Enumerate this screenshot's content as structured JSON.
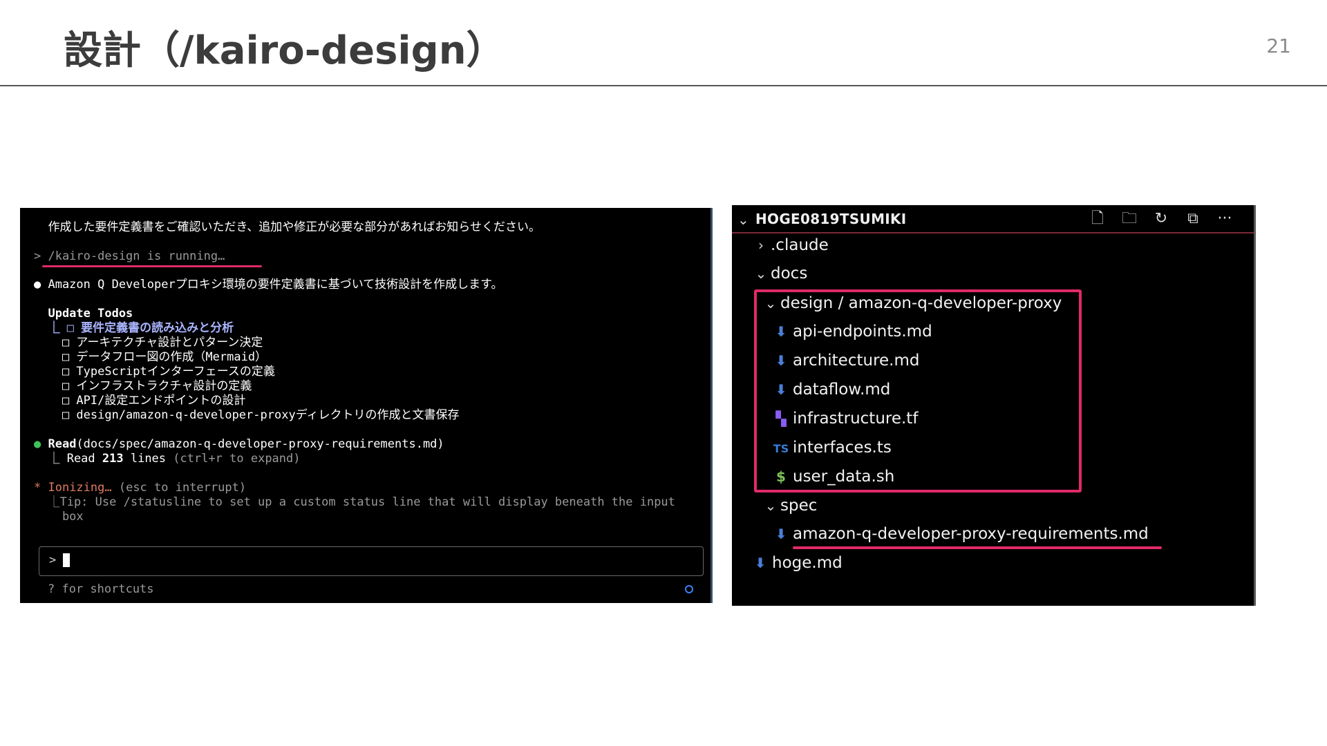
{
  "slide": {
    "title": "設計（/kairo-design）",
    "page_number": "21"
  },
  "terminal": {
    "lines": [
      "  作成した要件定義書をご確認いただき、追加や修正が必要な部分があればお知らせください。",
      "> /kairo-design is running…",
      "● Amazon Q Developerプロキシ環境の要件定義書に基づいて技術設計を作成します。",
      "  Update Todos",
      "  ⎿ □ 要件定義書の読み込みと分析",
      "    □ アーキテクチャ設計とパターン決定",
      "    □ データフロー図の作成（Mermaid）",
      "    □ TypeScriptインターフェースの定義",
      "    □ インフラストラクチャ設計の定義",
      "    □ API/設定エンドポイントの設計",
      "    □ design/amazon-q-developer-proxyディレクトリの作成と文書保存",
      "● Read(docs/spec/amazon-q-developer-proxy-requirements.md)",
      "  ⎿ Read 213 lines (ctrl+r to expand)",
      "* Ionizing… (esc to interrupt)",
      "  ⎿Tip: Use /statusline to set up a custom status line that will display beneath the input",
      "    box"
    ],
    "read_label": "Read",
    "read_args": "(docs/spec/amazon-q-developer-proxy-requirements.md)",
    "read_count_prefix": "  ⎿ Read ",
    "read_count": "213",
    "read_count_suffix": " lines",
    "read_expand_hint": " (ctrl+r to expand)",
    "ionizing": "Ionizing…",
    "interrupt_hint": " (esc to interrupt)",
    "input_prompt": ">",
    "shortcuts_hint": "? for shortcuts",
    "accent_red": "#e02a6a"
  },
  "explorer": {
    "title": "HOGE0819TSUMIKI",
    "toolbar": [
      {
        "icon": "new-file-icon",
        "glyph": "🗋"
      },
      {
        "icon": "new-folder-icon",
        "glyph": "🗀"
      },
      {
        "icon": "refresh-icon",
        "glyph": "↻"
      },
      {
        "icon": "collapse-all-icon",
        "glyph": "⧉"
      },
      {
        "icon": "more-icon",
        "glyph": "···"
      }
    ],
    "tree": [
      {
        "label": ".claude",
        "kind": "folder",
        "expanded": false
      },
      {
        "label": "docs",
        "kind": "folder",
        "expanded": true
      },
      {
        "label": "design / amazon-q-developer-proxy",
        "kind": "folder",
        "expanded": true
      },
      {
        "label": "api-endpoints.md",
        "kind": "md"
      },
      {
        "label": "architecture.md",
        "kind": "md"
      },
      {
        "label": "dataflow.md",
        "kind": "md"
      },
      {
        "label": "infrastructure.tf",
        "kind": "tf"
      },
      {
        "label": "interfaces.ts",
        "kind": "ts"
      },
      {
        "label": "user_data.sh",
        "kind": "sh"
      },
      {
        "label": "spec",
        "kind": "folder",
        "expanded": true
      },
      {
        "label": "amazon-q-developer-proxy-requirements.md",
        "kind": "md"
      },
      {
        "label": "hoge.md",
        "kind": "md"
      }
    ],
    "ts_glyph": "TS",
    "sh_glyph": "$"
  }
}
